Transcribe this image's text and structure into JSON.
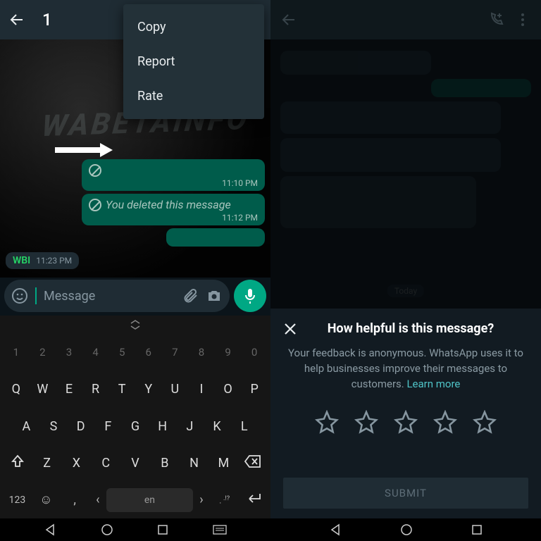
{
  "left": {
    "selection_count": "1",
    "menu": {
      "copy": "Copy",
      "report": "Report",
      "rate": "Rate"
    },
    "watermark": "WABETAINFO",
    "msg_deleted": "You deleted this message",
    "msg1_time": "11:10 PM",
    "msg2_time": "11:12 PM",
    "incoming_sender": "WBI",
    "incoming_time": "11:23 PM",
    "input_placeholder": "Message",
    "keyboard": {
      "numbers": [
        "1",
        "2",
        "3",
        "4",
        "5",
        "6",
        "7",
        "8",
        "9",
        "0"
      ],
      "row1": [
        "Q",
        "W",
        "E",
        "R",
        "T",
        "Y",
        "U",
        "I",
        "O",
        "P"
      ],
      "row2": [
        "A",
        "S",
        "D",
        "F",
        "G",
        "H",
        "J",
        "K",
        "L"
      ],
      "row3": [
        "Z",
        "X",
        "C",
        "V",
        "B",
        "N",
        "M"
      ],
      "k123": "123",
      "space": "en",
      "punct": ".!?"
    }
  },
  "right": {
    "today_chip": "Today",
    "sheet": {
      "title": "How helpful is this message?",
      "subtitle_a": "Your feedback is anonymous. WhatsApp uses it to help businesses improve their messages to customers. ",
      "learn_more": "Learn more",
      "submit": "SUBMIT"
    }
  }
}
